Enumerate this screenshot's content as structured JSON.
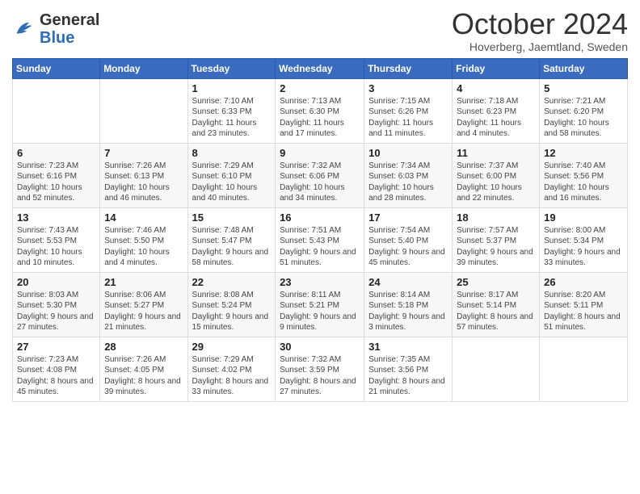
{
  "header": {
    "logo_general": "General",
    "logo_blue": "Blue",
    "month": "October 2024",
    "location": "Hoverberg, Jaemtland, Sweden"
  },
  "days_of_week": [
    "Sunday",
    "Monday",
    "Tuesday",
    "Wednesday",
    "Thursday",
    "Friday",
    "Saturday"
  ],
  "weeks": [
    [
      {
        "day": "",
        "info": ""
      },
      {
        "day": "",
        "info": ""
      },
      {
        "day": "1",
        "info": "Sunrise: 7:10 AM\nSunset: 6:33 PM\nDaylight: 11 hours\nand 23 minutes."
      },
      {
        "day": "2",
        "info": "Sunrise: 7:13 AM\nSunset: 6:30 PM\nDaylight: 11 hours\nand 17 minutes."
      },
      {
        "day": "3",
        "info": "Sunrise: 7:15 AM\nSunset: 6:26 PM\nDaylight: 11 hours\nand 11 minutes."
      },
      {
        "day": "4",
        "info": "Sunrise: 7:18 AM\nSunset: 6:23 PM\nDaylight: 11 hours\nand 4 minutes."
      },
      {
        "day": "5",
        "info": "Sunrise: 7:21 AM\nSunset: 6:20 PM\nDaylight: 10 hours\nand 58 minutes."
      }
    ],
    [
      {
        "day": "6",
        "info": "Sunrise: 7:23 AM\nSunset: 6:16 PM\nDaylight: 10 hours\nand 52 minutes."
      },
      {
        "day": "7",
        "info": "Sunrise: 7:26 AM\nSunset: 6:13 PM\nDaylight: 10 hours\nand 46 minutes."
      },
      {
        "day": "8",
        "info": "Sunrise: 7:29 AM\nSunset: 6:10 PM\nDaylight: 10 hours\nand 40 minutes."
      },
      {
        "day": "9",
        "info": "Sunrise: 7:32 AM\nSunset: 6:06 PM\nDaylight: 10 hours\nand 34 minutes."
      },
      {
        "day": "10",
        "info": "Sunrise: 7:34 AM\nSunset: 6:03 PM\nDaylight: 10 hours\nand 28 minutes."
      },
      {
        "day": "11",
        "info": "Sunrise: 7:37 AM\nSunset: 6:00 PM\nDaylight: 10 hours\nand 22 minutes."
      },
      {
        "day": "12",
        "info": "Sunrise: 7:40 AM\nSunset: 5:56 PM\nDaylight: 10 hours\nand 16 minutes."
      }
    ],
    [
      {
        "day": "13",
        "info": "Sunrise: 7:43 AM\nSunset: 5:53 PM\nDaylight: 10 hours\nand 10 minutes."
      },
      {
        "day": "14",
        "info": "Sunrise: 7:46 AM\nSunset: 5:50 PM\nDaylight: 10 hours\nand 4 minutes."
      },
      {
        "day": "15",
        "info": "Sunrise: 7:48 AM\nSunset: 5:47 PM\nDaylight: 9 hours\nand 58 minutes."
      },
      {
        "day": "16",
        "info": "Sunrise: 7:51 AM\nSunset: 5:43 PM\nDaylight: 9 hours\nand 51 minutes."
      },
      {
        "day": "17",
        "info": "Sunrise: 7:54 AM\nSunset: 5:40 PM\nDaylight: 9 hours\nand 45 minutes."
      },
      {
        "day": "18",
        "info": "Sunrise: 7:57 AM\nSunset: 5:37 PM\nDaylight: 9 hours\nand 39 minutes."
      },
      {
        "day": "19",
        "info": "Sunrise: 8:00 AM\nSunset: 5:34 PM\nDaylight: 9 hours\nand 33 minutes."
      }
    ],
    [
      {
        "day": "20",
        "info": "Sunrise: 8:03 AM\nSunset: 5:30 PM\nDaylight: 9 hours\nand 27 minutes."
      },
      {
        "day": "21",
        "info": "Sunrise: 8:06 AM\nSunset: 5:27 PM\nDaylight: 9 hours\nand 21 minutes."
      },
      {
        "day": "22",
        "info": "Sunrise: 8:08 AM\nSunset: 5:24 PM\nDaylight: 9 hours\nand 15 minutes."
      },
      {
        "day": "23",
        "info": "Sunrise: 8:11 AM\nSunset: 5:21 PM\nDaylight: 9 hours\nand 9 minutes."
      },
      {
        "day": "24",
        "info": "Sunrise: 8:14 AM\nSunset: 5:18 PM\nDaylight: 9 hours\nand 3 minutes."
      },
      {
        "day": "25",
        "info": "Sunrise: 8:17 AM\nSunset: 5:14 PM\nDaylight: 8 hours\nand 57 minutes."
      },
      {
        "day": "26",
        "info": "Sunrise: 8:20 AM\nSunset: 5:11 PM\nDaylight: 8 hours\nand 51 minutes."
      }
    ],
    [
      {
        "day": "27",
        "info": "Sunrise: 7:23 AM\nSunset: 4:08 PM\nDaylight: 8 hours\nand 45 minutes."
      },
      {
        "day": "28",
        "info": "Sunrise: 7:26 AM\nSunset: 4:05 PM\nDaylight: 8 hours\nand 39 minutes."
      },
      {
        "day": "29",
        "info": "Sunrise: 7:29 AM\nSunset: 4:02 PM\nDaylight: 8 hours\nand 33 minutes."
      },
      {
        "day": "30",
        "info": "Sunrise: 7:32 AM\nSunset: 3:59 PM\nDaylight: 8 hours\nand 27 minutes."
      },
      {
        "day": "31",
        "info": "Sunrise: 7:35 AM\nSunset: 3:56 PM\nDaylight: 8 hours\nand 21 minutes."
      },
      {
        "day": "",
        "info": ""
      },
      {
        "day": "",
        "info": ""
      }
    ]
  ]
}
